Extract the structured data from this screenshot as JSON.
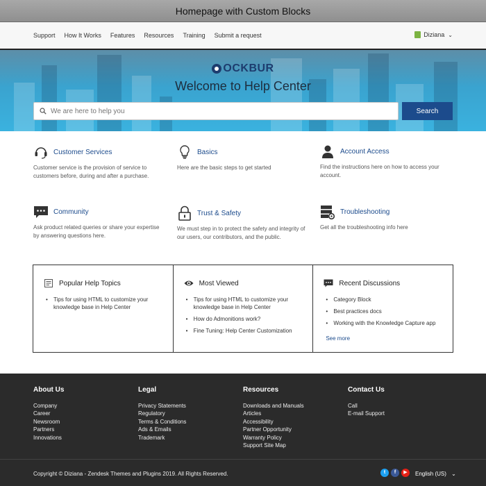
{
  "window": {
    "title": "Homepage with Custom Blocks"
  },
  "nav": {
    "items": [
      "Support",
      "How It Works",
      "Features",
      "Resources",
      "Training",
      "Submit a request"
    ],
    "user": "Diziana"
  },
  "hero": {
    "logo_text": "OCKBUR",
    "title": "Welcome to Help Center",
    "search_placeholder": "We are here to help you",
    "search_button": "Search"
  },
  "categories": [
    {
      "title": "Customer Services",
      "desc": "Customer service is the provision of service to customers before, during and after a purchase.",
      "icon": "headset-icon"
    },
    {
      "title": "Basics",
      "desc": "Here are the basic steps to get started",
      "icon": "lightbulb-icon"
    },
    {
      "title": "Account Access",
      "desc": "Find the instructions here on how to access your account.",
      "icon": "user-icon"
    },
    {
      "title": "Community",
      "desc": "Ask product related queries or share your expertise by answering questions here.",
      "icon": "chat-icon"
    },
    {
      "title": "Trust & Safety",
      "desc": "We must step in to protect the safety and integrity of our users, our contributors, and the public.",
      "icon": "lock-icon"
    },
    {
      "title": "Troubleshooting",
      "desc": "Get all the troubleshooting info here",
      "icon": "server-gear-icon"
    }
  ],
  "blocks": {
    "popular": {
      "title": "Popular Help Topics",
      "items": [
        "Tips for using HTML to customize your knowledge base in Help Center"
      ]
    },
    "viewed": {
      "title": "Most Viewed",
      "items": [
        "Tips for using HTML to customize your knowledge base in Help Center",
        "How do Admonitions work?",
        "Fine Tuning: Help Center Customization"
      ]
    },
    "discussions": {
      "title": "Recent Discussions",
      "items": [
        "Category Block",
        "Best practices docs",
        "Working with the Knowledge Capture app"
      ],
      "see_more": "See more"
    }
  },
  "footer": {
    "columns": [
      {
        "title": "About Us",
        "links": [
          "Company",
          "Career",
          "Newsroom",
          "Partners",
          "Innovations"
        ]
      },
      {
        "title": "Legal",
        "links": [
          "Privacy Statements",
          "Regulatory",
          "Terms & Conditions",
          "Ads & Emails",
          "Trademark"
        ]
      },
      {
        "title": "Resources",
        "links": [
          "Downloads and Manuals",
          "Articles",
          "Accessibility",
          "Partner Opportunity",
          "Warranty Policy",
          "Support Site Map"
        ]
      },
      {
        "title": "Contact Us",
        "links": [
          "Call",
          "E-mail Support"
        ]
      }
    ],
    "copyright": "Copyright © Diziana - Zendesk Themes and Plugins 2019. All Rights Reserved.",
    "language": "English (US)",
    "social": [
      "twitter-icon",
      "facebook-icon",
      "youtube-icon"
    ]
  },
  "colors": {
    "accent": "#1c4b8c",
    "hero": "#3aa3cf",
    "footer": "#2b2b2b"
  }
}
